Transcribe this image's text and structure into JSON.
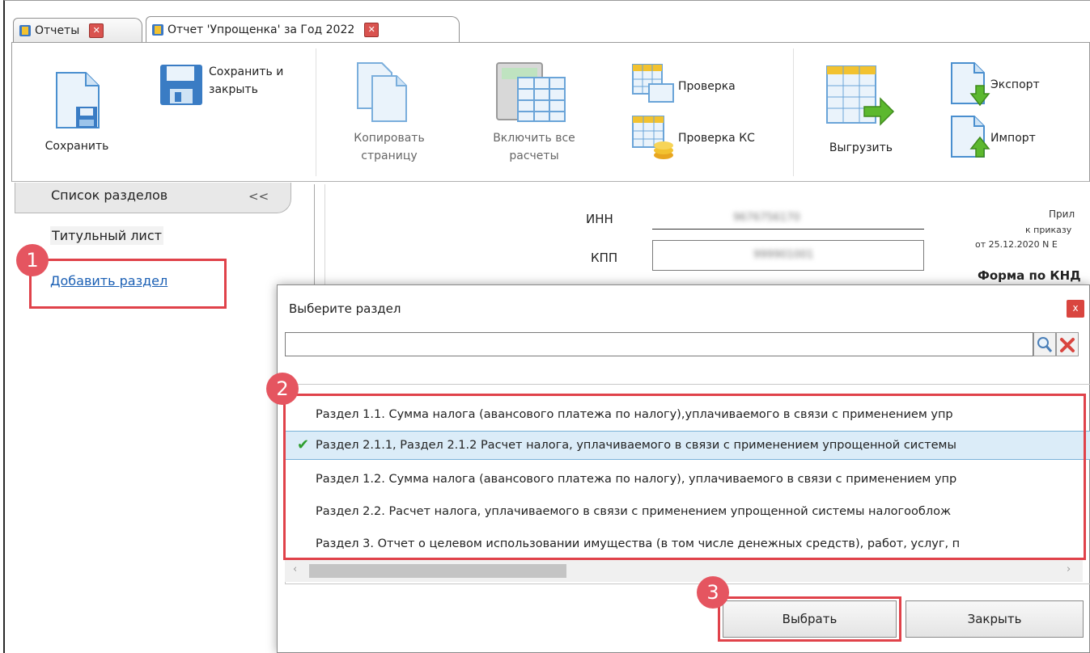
{
  "tabs": [
    {
      "label": "Отчеты",
      "close": "x"
    },
    {
      "label": "Отчет 'Упрощенка' за Год 2022",
      "close": "x"
    }
  ],
  "toolbar": {
    "save": "Сохранить",
    "save_close_line1": "Сохранить и",
    "save_close_line2": "закрыть",
    "copy_line1": "Копировать",
    "copy_line2": "страницу",
    "enable_line1": "Включить все",
    "enable_line2": "расчеты",
    "check": "Проверка",
    "check_ks": "Проверка КС",
    "upload": "Выгрузить",
    "export": "Экспорт",
    "import": "Импорт"
  },
  "left_panel": {
    "header": "Список разделов",
    "collapse": "<<",
    "items": [
      "Титульный лист"
    ],
    "add_link": "Добавить раздел"
  },
  "form": {
    "inn_label": "ИНН",
    "inn_value": "9676756170",
    "kpp_label": "КПП",
    "kpp_value": "999901001",
    "appendix_line1": "Прил",
    "appendix_line2": "к приказу",
    "appendix_line3": "от 25.12.2020 N Е",
    "knd": "Форма по КНД"
  },
  "dialog": {
    "title": "Выберите раздел",
    "close": "x",
    "search_value": "",
    "items": [
      {
        "text": "Раздел 1.1. Сумма налога (авансового платежа по налогу),уплачиваемого в связи с применением упр",
        "selected": false
      },
      {
        "text": "Раздел 2.1.1, Раздел 2.1.2 Расчет налога, уплачиваемого в связи с применением упрощенной системы",
        "selected": true
      },
      {
        "text": "Раздел 1.2. Сумма налога (авансового платежа по налогу), уплачиваемого в связи с применением упр",
        "selected": false
      },
      {
        "text": "Раздел 2.2. Расчет налога, уплачиваемого в связи с применением упрощенной системы налогооблож",
        "selected": false
      },
      {
        "text": "Раздел 3. Отчет о целевом использовании имущества (в том числе денежных средств), работ, услуг, п",
        "selected": false
      }
    ],
    "select_button": "Выбрать",
    "close_button": "Закрыть"
  },
  "annotations": [
    "1",
    "2",
    "3"
  ],
  "colors": {
    "annotation": "#e0424a",
    "selected_row": "#dbecf8",
    "link": "#1a5fb4",
    "check": "#2e9e2e"
  }
}
